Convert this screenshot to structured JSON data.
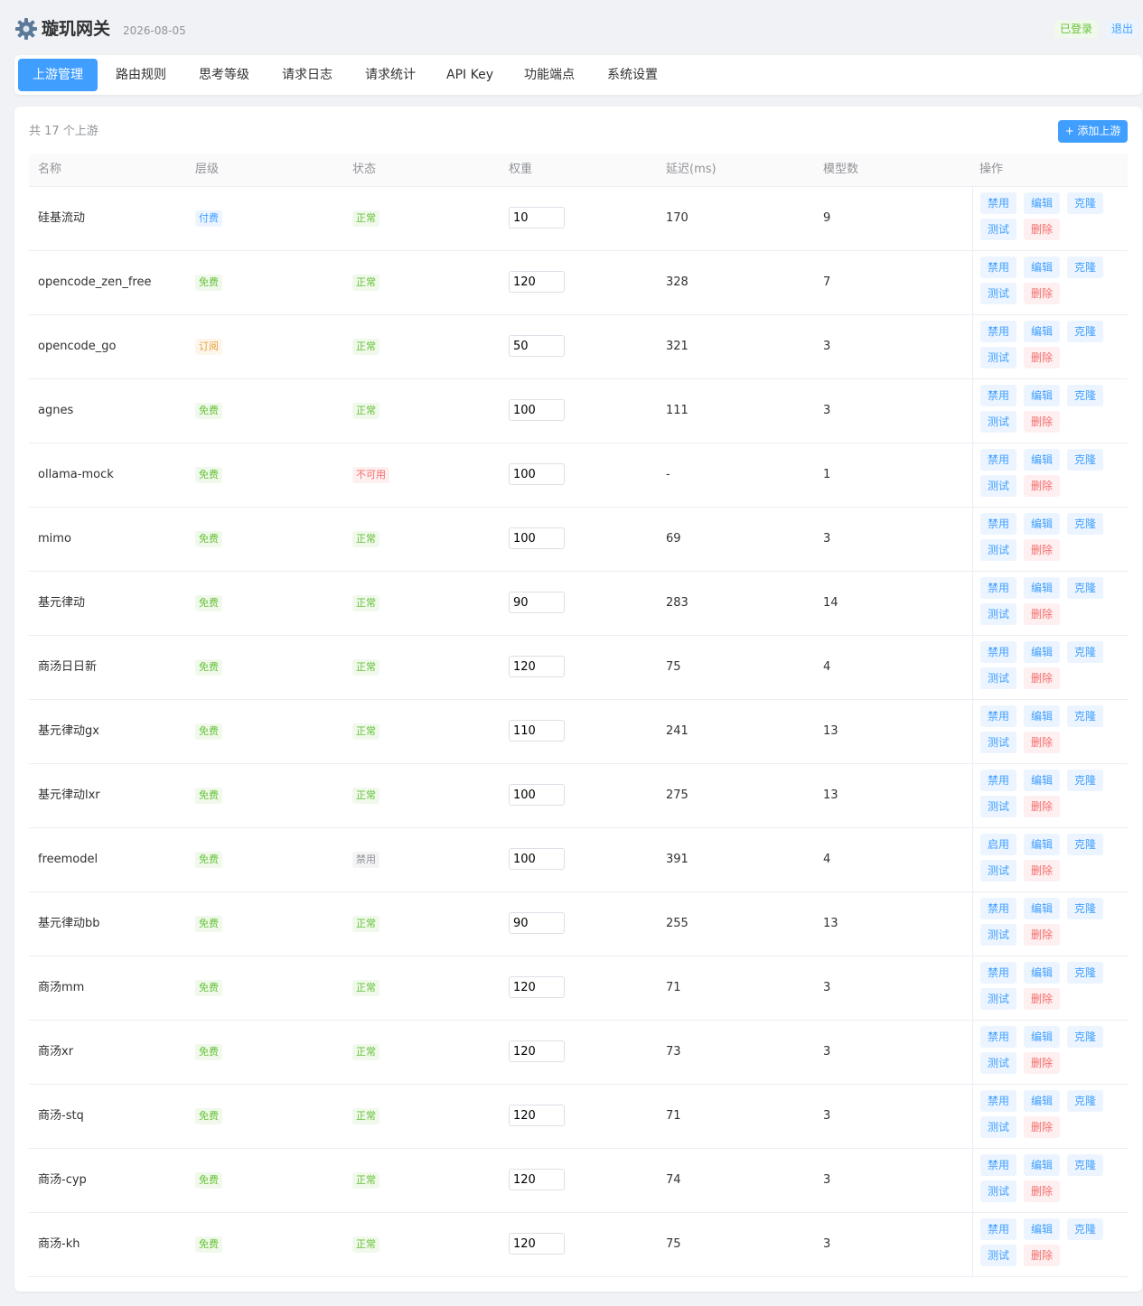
{
  "app": {
    "title": "璇玑网关",
    "date": "2026-08-05",
    "logo_icon": "gear-icon",
    "login_status": "已登录",
    "logout_label": "退出"
  },
  "tabs": [
    {
      "label": "上游管理",
      "active": true
    },
    {
      "label": "路由规则",
      "active": false
    },
    {
      "label": "思考等级",
      "active": false
    },
    {
      "label": "请求日志",
      "active": false
    },
    {
      "label": "请求统计",
      "active": false
    },
    {
      "label": "API Key",
      "active": false
    },
    {
      "label": "功能端点",
      "active": false
    },
    {
      "label": "系统设置",
      "active": false
    }
  ],
  "summary": {
    "count_text": "共 17 个上游",
    "add_button": "+ 添加上游"
  },
  "table": {
    "columns": [
      "名称",
      "层级",
      "状态",
      "权重",
      "延迟(ms)",
      "模型数",
      "操作"
    ],
    "actions": {
      "disable": "禁用",
      "enable": "启用",
      "edit": "编辑",
      "clone": "克隆",
      "test": "测试",
      "delete": "删除"
    },
    "rows": [
      {
        "name": "硅基流动",
        "tier": "付费",
        "tier_kind": "paid",
        "status": "正常",
        "status_kind": "ok",
        "weight": "10",
        "latency": "170",
        "models": "9",
        "toggle": "禁用"
      },
      {
        "name": "opencode_zen_free",
        "tier": "免费",
        "tier_kind": "free",
        "status": "正常",
        "status_kind": "ok",
        "weight": "120",
        "latency": "328",
        "models": "7",
        "toggle": "禁用"
      },
      {
        "name": "opencode_go",
        "tier": "订阅",
        "tier_kind": "sub",
        "status": "正常",
        "status_kind": "ok",
        "weight": "50",
        "latency": "321",
        "models": "3",
        "toggle": "禁用"
      },
      {
        "name": "agnes",
        "tier": "免费",
        "tier_kind": "free",
        "status": "正常",
        "status_kind": "ok",
        "weight": "100",
        "latency": "111",
        "models": "3",
        "toggle": "禁用"
      },
      {
        "name": "ollama-mock",
        "tier": "免费",
        "tier_kind": "free",
        "status": "不可用",
        "status_kind": "bad",
        "weight": "100",
        "latency": "-",
        "models": "1",
        "toggle": "禁用"
      },
      {
        "name": "mimo",
        "tier": "免费",
        "tier_kind": "free",
        "status": "正常",
        "status_kind": "ok",
        "weight": "100",
        "latency": "69",
        "models": "3",
        "toggle": "禁用"
      },
      {
        "name": "基元律动",
        "tier": "免费",
        "tier_kind": "free",
        "status": "正常",
        "status_kind": "ok",
        "weight": "90",
        "latency": "283",
        "models": "14",
        "toggle": "禁用"
      },
      {
        "name": "商汤日日新",
        "tier": "免费",
        "tier_kind": "free",
        "status": "正常",
        "status_kind": "ok",
        "weight": "120",
        "latency": "75",
        "models": "4",
        "toggle": "禁用"
      },
      {
        "name": "基元律动gx",
        "tier": "免费",
        "tier_kind": "free",
        "status": "正常",
        "status_kind": "ok",
        "weight": "110",
        "latency": "241",
        "models": "13",
        "toggle": "禁用"
      },
      {
        "name": "基元律动lxr",
        "tier": "免费",
        "tier_kind": "free",
        "status": "正常",
        "status_kind": "ok",
        "weight": "100",
        "latency": "275",
        "models": "13",
        "toggle": "禁用"
      },
      {
        "name": "freemodel",
        "tier": "免费",
        "tier_kind": "free",
        "status": "禁用",
        "status_kind": "off",
        "weight": "100",
        "latency": "391",
        "models": "4",
        "toggle": "启用"
      },
      {
        "name": "基元律动bb",
        "tier": "免费",
        "tier_kind": "free",
        "status": "正常",
        "status_kind": "ok",
        "weight": "90",
        "latency": "255",
        "models": "13",
        "toggle": "禁用"
      },
      {
        "name": "商汤mm",
        "tier": "免费",
        "tier_kind": "free",
        "status": "正常",
        "status_kind": "ok",
        "weight": "120",
        "latency": "71",
        "models": "3",
        "toggle": "禁用"
      },
      {
        "name": "商汤xr",
        "tier": "免费",
        "tier_kind": "free",
        "status": "正常",
        "status_kind": "ok",
        "weight": "120",
        "latency": "73",
        "models": "3",
        "toggle": "禁用"
      },
      {
        "name": "商汤-stq",
        "tier": "免费",
        "tier_kind": "free",
        "status": "正常",
        "status_kind": "ok",
        "weight": "120",
        "latency": "71",
        "models": "3",
        "toggle": "禁用"
      },
      {
        "name": "商汤-cyp",
        "tier": "免费",
        "tier_kind": "free",
        "status": "正常",
        "status_kind": "ok",
        "weight": "120",
        "latency": "74",
        "models": "3",
        "toggle": "禁用"
      },
      {
        "name": "商汤-kh",
        "tier": "免费",
        "tier_kind": "free",
        "status": "正常",
        "status_kind": "ok",
        "weight": "120",
        "latency": "75",
        "models": "3",
        "toggle": "禁用"
      }
    ]
  },
  "colors": {
    "accent": "#409eff",
    "success": "#67c23a",
    "warning": "#e6a23c",
    "danger": "#f56c6c",
    "muted": "#909399",
    "background": "#f0f2f5"
  }
}
